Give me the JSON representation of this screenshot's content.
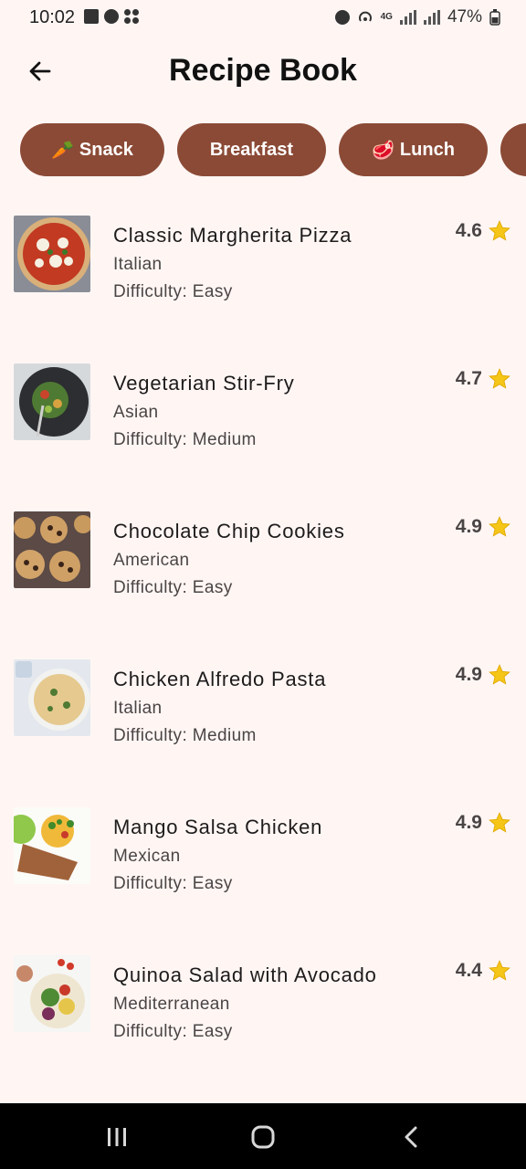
{
  "status_bar": {
    "time": "10:02",
    "battery": "47%",
    "network": "4G"
  },
  "header": {
    "title": "Recipe Book",
    "back_icon": "arrow-left-icon"
  },
  "chips": [
    {
      "emoji": "🥕",
      "label": "Snack"
    },
    {
      "emoji": "",
      "label": "Breakfast"
    },
    {
      "emoji": "🥩",
      "label": "Lunch"
    }
  ],
  "recipes": [
    {
      "name": "Classic Margherita Pizza",
      "cuisine": "Italian",
      "difficulty": "Difficulty: Easy",
      "rating": "4.6"
    },
    {
      "name": "Vegetarian Stir-Fry",
      "cuisine": "Asian",
      "difficulty": "Difficulty: Medium",
      "rating": "4.7"
    },
    {
      "name": "Chocolate Chip Cookies",
      "cuisine": "American",
      "difficulty": "Difficulty: Easy",
      "rating": "4.9"
    },
    {
      "name": "Chicken Alfredo Pasta",
      "cuisine": "Italian",
      "difficulty": "Difficulty: Medium",
      "rating": "4.9"
    },
    {
      "name": "Mango Salsa Chicken",
      "cuisine": "Mexican",
      "difficulty": "Difficulty: Easy",
      "rating": "4.9"
    },
    {
      "name": "Quinoa Salad with Avocado",
      "cuisine": "Mediterranean",
      "difficulty": "Difficulty: Easy",
      "rating": "4.4"
    }
  ],
  "colors": {
    "background": "#fff6f4",
    "chip": "#8b4a36",
    "star": "#f5c518",
    "nav_bar": "#000000"
  }
}
